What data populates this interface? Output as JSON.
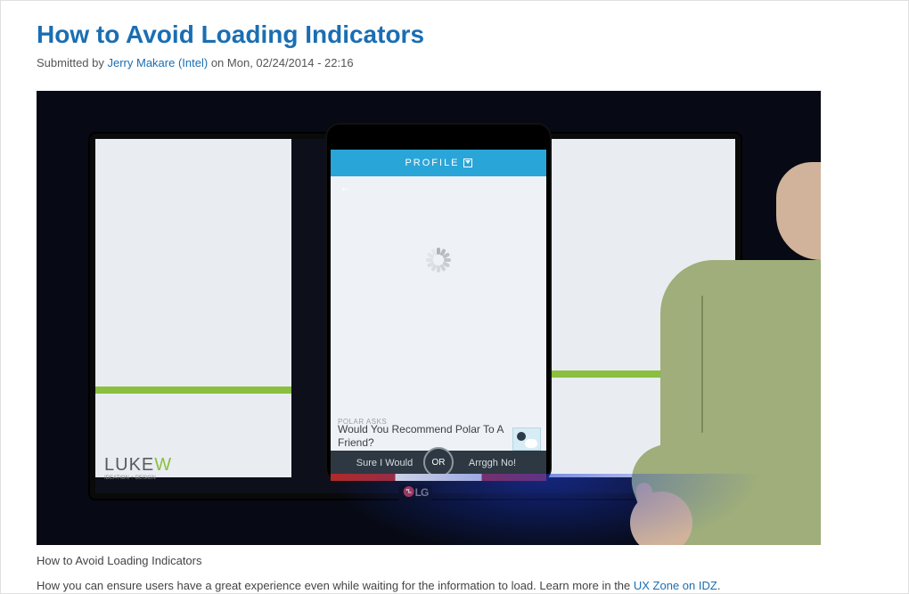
{
  "title": "How to Avoid Loading Indicators",
  "byline": {
    "submitted": "Submitted by ",
    "author": "Jerry Makare (Intel)",
    "on": " on Mon, 02/24/2014 - 22:16"
  },
  "slide": {
    "brand": "LUKE",
    "brand_w": "W",
    "brand_sub": "IDEATION + DESIGN",
    "app": {
      "title": "PROFILE",
      "ask_label": "POLAR ASKS",
      "question": "Would You Recommend Polar To A Friend?",
      "left_btn": "Sure I Would",
      "or": "OR",
      "right_btn": "Arrggh No!"
    },
    "tv_brand": "LG"
  },
  "caption": {
    "line1": "How to Avoid Loading Indicators",
    "line2a": "How you can ensure users have a great experience even while waiting for the information to load. Learn more in the ",
    "link": "UX Zone on IDZ",
    "line2b": "."
  }
}
